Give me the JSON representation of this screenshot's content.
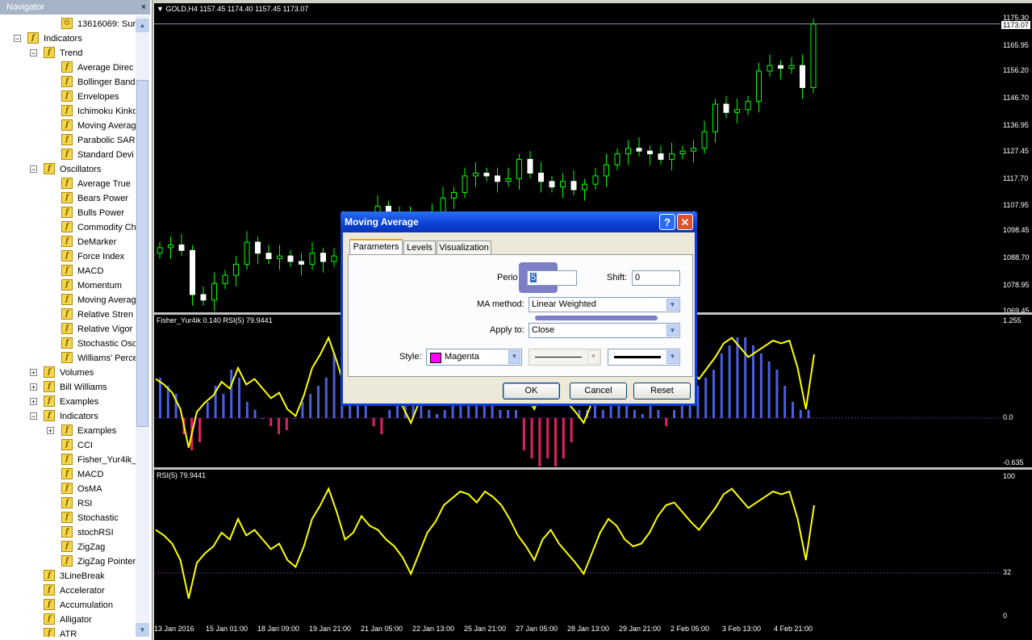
{
  "navigator": {
    "title": "Navigator",
    "close": "×",
    "items": [
      {
        "label": "13616069: Sur",
        "depth": 3,
        "expander": "",
        "icon": "account-icon"
      },
      {
        "label": "Indicators",
        "depth": 1,
        "expander": "−"
      },
      {
        "label": "Trend",
        "depth": 2,
        "expander": "−"
      },
      {
        "label": "Average Direc",
        "depth": 3,
        "expander": ""
      },
      {
        "label": "Bollinger Bands",
        "depth": 3,
        "expander": ""
      },
      {
        "label": "Envelopes",
        "depth": 3,
        "expander": ""
      },
      {
        "label": "Ichimoku Kinko",
        "depth": 3,
        "expander": ""
      },
      {
        "label": "Moving Averag",
        "depth": 3,
        "expander": ""
      },
      {
        "label": "Parabolic SAR",
        "depth": 3,
        "expander": ""
      },
      {
        "label": "Standard Devi",
        "depth": 3,
        "expander": ""
      },
      {
        "label": "Oscillators",
        "depth": 2,
        "expander": "−"
      },
      {
        "label": "Average True",
        "depth": 3,
        "expander": ""
      },
      {
        "label": "Bears Power",
        "depth": 3,
        "expander": ""
      },
      {
        "label": "Bulls Power",
        "depth": 3,
        "expander": ""
      },
      {
        "label": "Commodity Ch",
        "depth": 3,
        "expander": ""
      },
      {
        "label": "DeMarker",
        "depth": 3,
        "expander": ""
      },
      {
        "label": "Force Index",
        "depth": 3,
        "expander": ""
      },
      {
        "label": "MACD",
        "depth": 3,
        "expander": ""
      },
      {
        "label": "Momentum",
        "depth": 3,
        "expander": ""
      },
      {
        "label": "Moving Averag",
        "depth": 3,
        "expander": ""
      },
      {
        "label": "Relative Stren",
        "depth": 3,
        "expander": ""
      },
      {
        "label": "Relative Vigor",
        "depth": 3,
        "expander": ""
      },
      {
        "label": "Stochastic Osc",
        "depth": 3,
        "expander": ""
      },
      {
        "label": "Williams' Perce",
        "depth": 3,
        "expander": ""
      },
      {
        "label": "Volumes",
        "depth": 2,
        "expander": "+"
      },
      {
        "label": "Bill Williams",
        "depth": 2,
        "expander": "+"
      },
      {
        "label": "Examples",
        "depth": 2,
        "expander": "+"
      },
      {
        "label": "Indicators",
        "depth": 2,
        "expander": "−"
      },
      {
        "label": "Examples",
        "depth": 3,
        "expander": "+"
      },
      {
        "label": "CCI",
        "depth": 3,
        "expander": ""
      },
      {
        "label": "Fisher_Yur4ik_",
        "depth": 3,
        "expander": ""
      },
      {
        "label": "MACD",
        "depth": 3,
        "expander": ""
      },
      {
        "label": "OsMA",
        "depth": 3,
        "expander": ""
      },
      {
        "label": "RSI",
        "depth": 3,
        "expander": ""
      },
      {
        "label": "Stochastic",
        "depth": 3,
        "expander": ""
      },
      {
        "label": "stochRSI",
        "depth": 3,
        "expander": ""
      },
      {
        "label": "ZigZag",
        "depth": 3,
        "expander": ""
      },
      {
        "label": "ZigZag Pointer",
        "depth": 3,
        "expander": ""
      },
      {
        "label": "3LineBreak",
        "depth": 2,
        "expander": ""
      },
      {
        "label": "Accelerator",
        "depth": 2,
        "expander": ""
      },
      {
        "label": "Accumulation",
        "depth": 2,
        "expander": ""
      },
      {
        "label": "Alligator",
        "depth": 2,
        "expander": ""
      },
      {
        "label": "ATR",
        "depth": 2,
        "expander": ""
      }
    ]
  },
  "main_chart": {
    "title": "▼ GOLD,H4  1157.45 1174.40 1157.45 1173.07",
    "price_labels": [
      "1175.30",
      "1173.07",
      "1165.95",
      "1156.20",
      "1146.70",
      "1136.95",
      "1127.45",
      "1117.70",
      "1107.95",
      "1098.45",
      "1088.70",
      "1078.95",
      "1069.45"
    ],
    "current_price": "1173.07",
    "candle_color": "#00ff00"
  },
  "fisher_panel": {
    "title": "Fisher_Yur4ik 0.140  RSI(5) 79.9441",
    "labels": [
      "1.255",
      "0.0",
      "-0.635"
    ],
    "up_color": "#4a5ee0",
    "down_color": "#e0206a",
    "line_color": "#ffff00"
  },
  "rsi_panel": {
    "title": "RSI(5) 79.9441",
    "labels": [
      "100",
      "32",
      "0"
    ],
    "line_color": "#ffff00"
  },
  "x_axis": [
    "13 Jan 2016",
    "15 Jan 01:00",
    "18 Jan 09:00",
    "19 Jan 21:00",
    "21 Jan 05:00",
    "22 Jan 13:00",
    "25 Jan 21:00",
    "27 Jan 05:00",
    "28 Jan 13:00",
    "29 Jan 21:00",
    "2 Feb 05:00",
    "3 Feb 13:00",
    "4 Feb 21:00"
  ],
  "chart_data": {
    "type": "line",
    "title": "GOLD,H4",
    "ohlc_header": {
      "open": 1157.45,
      "high": 1174.4,
      "low": 1157.45,
      "close": 1173.07
    },
    "ylim": [
      1069.45,
      1175.3
    ],
    "close_series": [
      1092,
      1093,
      1091,
      1075,
      1073,
      1079,
      1082,
      1086,
      1094,
      1090,
      1088,
      1089,
      1087,
      1086,
      1090,
      1087,
      1089,
      1091,
      1096,
      1102,
      1107,
      1104,
      1103,
      1101,
      1102,
      1105,
      1110,
      1112,
      1118,
      1119,
      1118,
      1116,
      1117,
      1124,
      1119,
      1116,
      1114,
      1116,
      1113,
      1115,
      1118,
      1122,
      1126,
      1128,
      1127,
      1126,
      1124,
      1126,
      1127,
      1128,
      1134,
      1144,
      1141,
      1142,
      1145,
      1156,
      1158,
      1157,
      1158,
      1150,
      1173
    ]
  },
  "dialog": {
    "title": "Moving Average",
    "help": "?",
    "close": "✕",
    "tabs": [
      "Parameters",
      "Levels",
      "Visualization"
    ],
    "period_label": "Perio",
    "period_value": "5",
    "shift_label": "Shift:",
    "shift_value": "0",
    "ma_method_label": "MA method:",
    "ma_method_value": "Linear Weighted",
    "apply_label": "Apply to:",
    "apply_value": "Close",
    "style_label": "Style:",
    "style_color_name": "Magenta",
    "style_color": "#ff00ff",
    "ok": "OK",
    "cancel": "Cancel",
    "reset": "Reset"
  }
}
